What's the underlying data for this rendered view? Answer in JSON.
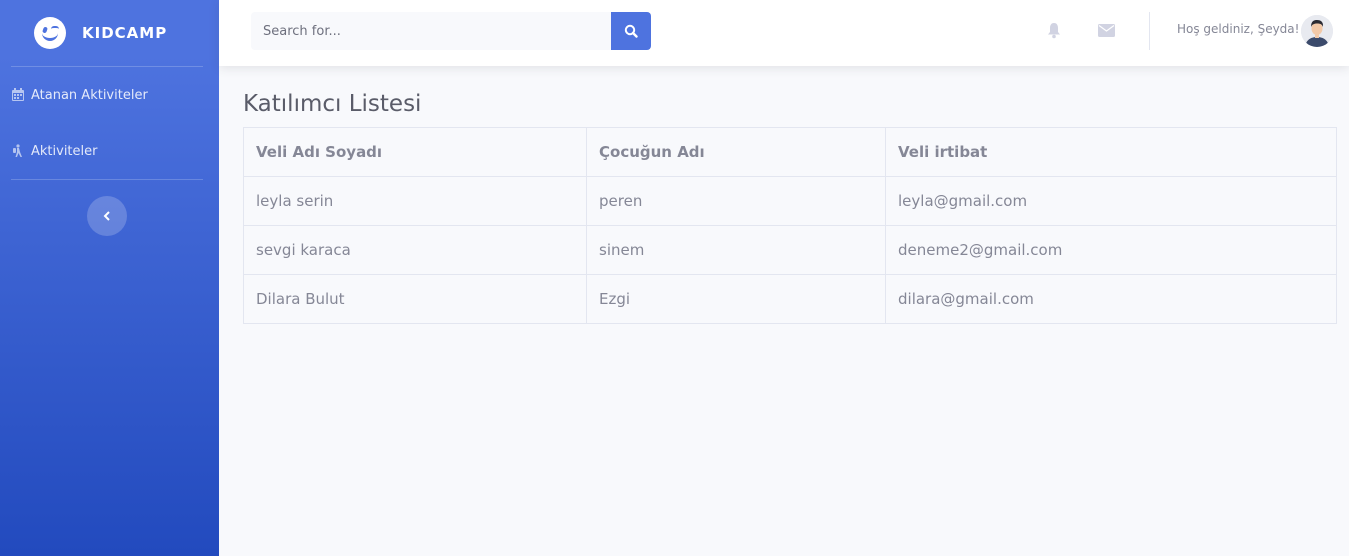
{
  "sidebar": {
    "brand": "KIDCAMP",
    "items": [
      {
        "label": "Atanan Aktiviteler",
        "icon": "calendar-icon"
      },
      {
        "label": "Aktiviteler",
        "icon": "hiking-icon"
      }
    ],
    "toggle_icon": "chevron-left-icon"
  },
  "topbar": {
    "search_placeholder": "Search for...",
    "welcome": "Hoş geldiniz, Şeyda!",
    "icons": [
      "bell-icon",
      "envelope-icon",
      "search-icon"
    ]
  },
  "main": {
    "title": "Katılımcı Listesi",
    "table": {
      "headers": [
        "Veli Adı Soyadı",
        "Çocuğun Adı",
        "Veli irtibat"
      ],
      "rows": [
        [
          "leyla serin",
          "peren",
          "leyla@gmail.com"
        ],
        [
          "sevgi karaca",
          "sinem",
          "deneme2@gmail.com"
        ],
        [
          "Dilara Bulut",
          "Ezgi",
          "dilara@gmail.com"
        ]
      ]
    }
  },
  "colors": {
    "primary": "#4e73df",
    "primary_dark": "#224abe",
    "background": "#f8f9fc",
    "text": "#858796"
  }
}
